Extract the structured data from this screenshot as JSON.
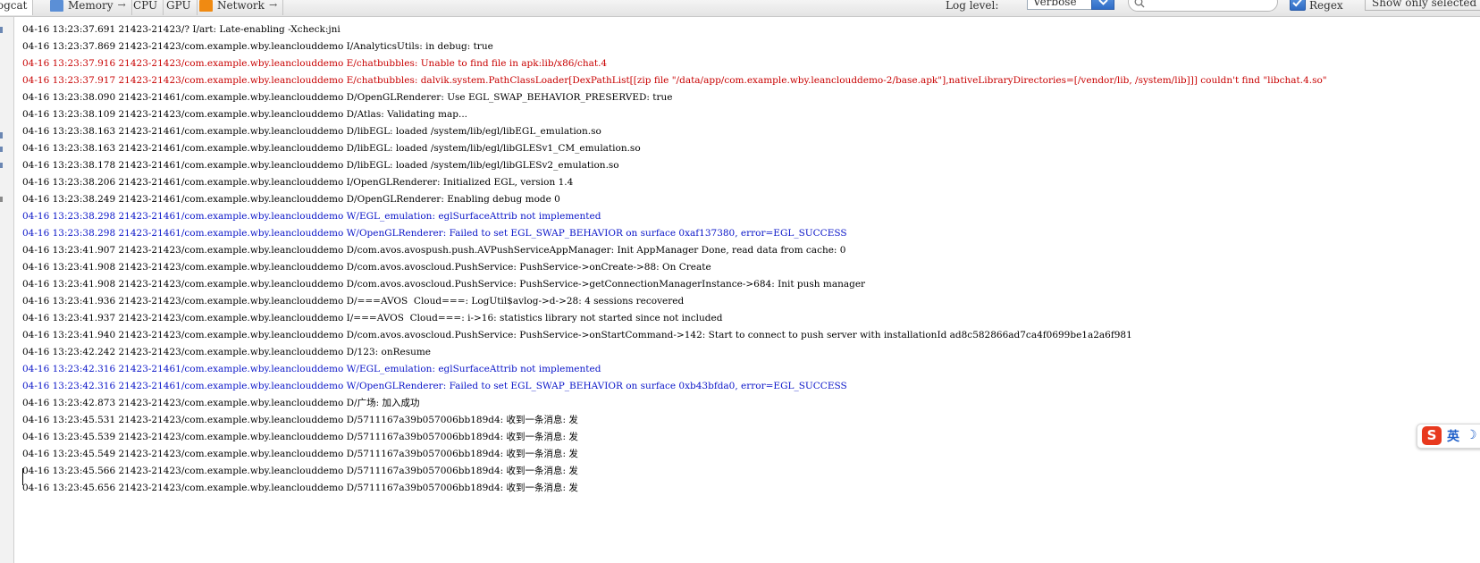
{
  "toolbar": {
    "tabs": [
      {
        "label": "logcat",
        "icon": "none",
        "active": true
      },
      {
        "label": "Memory",
        "icon": "memory-icon",
        "color": "#5b8fd6",
        "arrow": "→"
      },
      {
        "label": "CPU",
        "icon": "none"
      },
      {
        "label": "GPU",
        "icon": "none"
      },
      {
        "label": "Network",
        "icon": "network-icon",
        "color": "#f08a12",
        "arrow": "→"
      }
    ],
    "log_level_label": "Log level:",
    "log_level_value": "Verbose",
    "search_value": "",
    "regex_label": "Regex",
    "regex_checked": true,
    "show_only_label": "Show only selected application"
  },
  "log": [
    {
      "level": "I",
      "text": "04-16 13:23:37.691 21423-21423/? I/art: Late-enabling -Xcheck:jni"
    },
    {
      "level": "I",
      "text": "04-16 13:23:37.869 21423-21423/com.example.wby.leanclouddemo I/AnalyticsUtils: in debug: true"
    },
    {
      "level": "E",
      "text": "04-16 13:23:37.916 21423-21423/com.example.wby.leanclouddemo E/chatbubbles: Unable to find file in apk:lib/x86/chat.4"
    },
    {
      "level": "E",
      "text": "04-16 13:23:37.917 21423-21423/com.example.wby.leanclouddemo E/chatbubbles: dalvik.system.PathClassLoader[DexPathList[[zip file \"/data/app/com.example.wby.leanclouddemo-2/base.apk\"],nativeLibraryDirectories=[/vendor/lib, /system/lib]]] couldn't find \"libchat.4.so\""
    },
    {
      "level": "D",
      "text": "04-16 13:23:38.090 21423-21461/com.example.wby.leanclouddemo D/OpenGLRenderer: Use EGL_SWAP_BEHAVIOR_PRESERVED: true"
    },
    {
      "level": "D",
      "text": "04-16 13:23:38.109 21423-21423/com.example.wby.leanclouddemo D/Atlas: Validating map..."
    },
    {
      "level": "D",
      "text": "04-16 13:23:38.163 21423-21461/com.example.wby.leanclouddemo D/libEGL: loaded /system/lib/egl/libEGL_emulation.so"
    },
    {
      "level": "D",
      "text": "04-16 13:23:38.163 21423-21461/com.example.wby.leanclouddemo D/libEGL: loaded /system/lib/egl/libGLESv1_CM_emulation.so"
    },
    {
      "level": "D",
      "text": "04-16 13:23:38.178 21423-21461/com.example.wby.leanclouddemo D/libEGL: loaded /system/lib/egl/libGLESv2_emulation.so"
    },
    {
      "level": "I",
      "text": "04-16 13:23:38.206 21423-21461/com.example.wby.leanclouddemo I/OpenGLRenderer: Initialized EGL, version 1.4"
    },
    {
      "level": "D",
      "text": "04-16 13:23:38.249 21423-21461/com.example.wby.leanclouddemo D/OpenGLRenderer: Enabling debug mode 0"
    },
    {
      "level": "W",
      "text": "04-16 13:23:38.298 21423-21461/com.example.wby.leanclouddemo W/EGL_emulation: eglSurfaceAttrib not implemented"
    },
    {
      "level": "W",
      "text": "04-16 13:23:38.298 21423-21461/com.example.wby.leanclouddemo W/OpenGLRenderer: Failed to set EGL_SWAP_BEHAVIOR on surface 0xaf137380, error=EGL_SUCCESS"
    },
    {
      "level": "D",
      "text": "04-16 13:23:41.907 21423-21423/com.example.wby.leanclouddemo D/com.avos.avospush.push.AVPushServiceAppManager: Init AppManager Done, read data from cache: 0"
    },
    {
      "level": "D",
      "text": "04-16 13:23:41.908 21423-21423/com.example.wby.leanclouddemo D/com.avos.avoscloud.PushService: PushService->onCreate->88: On Create"
    },
    {
      "level": "D",
      "text": "04-16 13:23:41.908 21423-21423/com.example.wby.leanclouddemo D/com.avos.avoscloud.PushService: PushService->getConnectionManagerInstance->684: Init push manager"
    },
    {
      "level": "D",
      "text": "04-16 13:23:41.936 21423-21423/com.example.wby.leanclouddemo D/===AVOS  Cloud===: LogUtil$avlog->d->28: 4 sessions recovered"
    },
    {
      "level": "I",
      "text": "04-16 13:23:41.937 21423-21423/com.example.wby.leanclouddemo I/===AVOS  Cloud===: i->16: statistics library not started since not included"
    },
    {
      "level": "D",
      "text": "04-16 13:23:41.940 21423-21423/com.example.wby.leanclouddemo D/com.avos.avoscloud.PushService: PushService->onStartCommand->142: Start to connect to push server with installationId ad8c582866ad7ca4f0699be1a2a6f981"
    },
    {
      "level": "D",
      "text": "04-16 13:23:42.242 21423-21423/com.example.wby.leanclouddemo D/123: onResume"
    },
    {
      "level": "W",
      "text": "04-16 13:23:42.316 21423-21461/com.example.wby.leanclouddemo W/EGL_emulation: eglSurfaceAttrib not implemented"
    },
    {
      "level": "W",
      "text": "04-16 13:23:42.316 21423-21461/com.example.wby.leanclouddemo W/OpenGLRenderer: Failed to set EGL_SWAP_BEHAVIOR on surface 0xb43bfda0, error=EGL_SUCCESS"
    },
    {
      "level": "D",
      "text": "04-16 13:23:42.873 21423-21423/com.example.wby.leanclouddemo D/广场: 加入成功"
    },
    {
      "level": "D",
      "text": "04-16 13:23:45.531 21423-21423/com.example.wby.leanclouddemo D/5711167a39b057006bb189d4: 收到一条消息: 发"
    },
    {
      "level": "D",
      "text": "04-16 13:23:45.539 21423-21423/com.example.wby.leanclouddemo D/5711167a39b057006bb189d4: 收到一条消息: 发"
    },
    {
      "level": "D",
      "text": "04-16 13:23:45.549 21423-21423/com.example.wby.leanclouddemo D/5711167a39b057006bb189d4: 收到一条消息: 发"
    },
    {
      "level": "D",
      "text": "04-16 13:23:45.566 21423-21423/com.example.wby.leanclouddemo D/5711167a39b057006bb189d4: 收到一条消息: 发"
    },
    {
      "level": "D",
      "text": "04-16 13:23:45.656 21423-21423/com.example.wby.leanclouddemo D/5711167a39b057006bb189d4: 收到一条消息: 发"
    }
  ],
  "ime": {
    "logo": "S",
    "lang": "英",
    "mode_icon": "moon-icon"
  },
  "colors": {
    "error": "#c80000",
    "warning": "#0a15c8",
    "accent": "#2f6cc6"
  }
}
